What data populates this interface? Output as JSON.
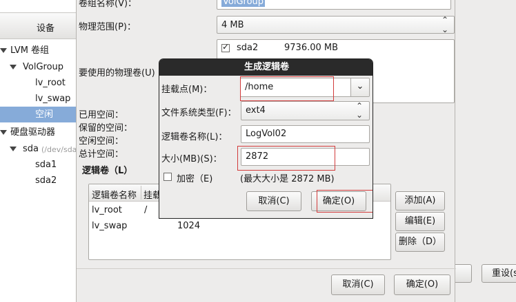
{
  "left": {
    "header": "设备",
    "tree": [
      {
        "label": "LVM 卷组",
        "expander": true
      },
      {
        "label": "VolGroup",
        "expander": true
      },
      {
        "label": "lv_root",
        "expander": false
      },
      {
        "label": "lv_swap",
        "expander": false
      },
      {
        "label": "空闲",
        "expander": false,
        "selected": true
      },
      {
        "label": "硬盘驱动器",
        "expander": true
      },
      {
        "label": "sda",
        "sub": "(/dev/sda",
        "expander": true
      },
      {
        "label": "sda1",
        "expander": false
      },
      {
        "label": "sda2",
        "expander": false
      }
    ]
  },
  "editor": {
    "vg_name_label": "卷组名称(V)：",
    "vg_name_value": "VolGroup",
    "pe_label": "物理范围(P)：",
    "pe_value": "4 MB",
    "pv_label": "要使用的物理卷(U)",
    "pv_item": {
      "name": "sda2",
      "size": "9736.00 MB",
      "checked": true
    },
    "used_label": "已用空间：",
    "reserved_label": "保留的空间：",
    "free_label": "空闲空间：",
    "total_label": "总计空间：",
    "lv_section": "逻辑卷（L）",
    "lv_columns": [
      "逻辑卷名称",
      "挂载"
    ],
    "lv_rows": [
      {
        "name": "lv_root",
        "mount": "/",
        "size": ""
      },
      {
        "name": "lv_swap",
        "mount": "",
        "size": "1024"
      }
    ],
    "add_button": "添加(A)",
    "edit_button": "编辑(E)",
    "delete_button": "删除（D）",
    "cancel_button": "取消(C)",
    "ok_button": "确定(O)"
  },
  "right": {
    "reset_button": "重设(s"
  },
  "modal": {
    "title": "生成逻辑卷",
    "mount_label": "挂载点(M)：",
    "mount_value": "/home",
    "fstype_label": "文件系统类型(F)：",
    "fstype_value": "ext4",
    "lvname_label": "逻辑卷名称(L)：",
    "lvname_value": "LogVol02",
    "size_label": "大小(MB)(S)：",
    "size_value": "2872",
    "encrypt_label": "加密（E)",
    "encrypt_checked": false,
    "max_size_note": "(最大大小是 2872 MB)",
    "cancel_button": "取消(C)",
    "ok_button": "确定(O)"
  }
}
